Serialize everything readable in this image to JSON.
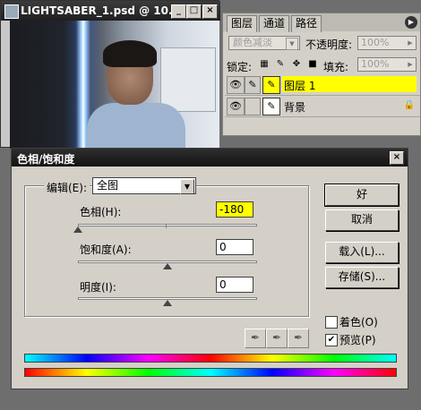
{
  "document": {
    "title": "LIGHTSABER_1.psd @ 10...",
    "minimize": "_",
    "maximize": "□",
    "close": "×"
  },
  "layers_panel": {
    "tabs": [
      {
        "label": "图层"
      },
      {
        "label": "通道"
      },
      {
        "label": "路径"
      }
    ],
    "blend_mode": "颜色减淡",
    "opacity_label": "不透明度:",
    "opacity_value": "100%",
    "lock_label": "锁定:",
    "fill_label": "填充:",
    "fill_value": "100%",
    "layers": [
      {
        "name": "图层 1",
        "selected": true,
        "highlight_color": "#ffff00"
      },
      {
        "name": "背景",
        "selected": false,
        "locked": true
      }
    ]
  },
  "dialog": {
    "title": "色相/饱和度",
    "edit_label": "编辑(E):",
    "edit_value": "全图",
    "hue_label": "色相(H):",
    "hue_value": "-180",
    "hue_level": -180,
    "saturation_label": "饱和度(A):",
    "saturation_value": "0",
    "saturation_level": 0,
    "lightness_label": "明度(I):",
    "lightness_value": "0",
    "lightness_level": 0,
    "buttons": {
      "ok": "好",
      "cancel": "取消",
      "load": "载入(L)...",
      "save": "存储(S)..."
    },
    "colorize_label": "着色(O)",
    "colorize_checked": false,
    "preview_label": "预览(P)",
    "preview_checked": true,
    "highlight_color": "#ffff00"
  },
  "icons": {
    "panel_menu": "arrow-right-icon",
    "eye": "eye-icon",
    "brush": "brush-icon",
    "lock": "lock-icon",
    "eyedroppers": [
      "eyedropper-icon",
      "eyedropper-plus-icon",
      "eyedropper-minus-icon"
    ]
  }
}
